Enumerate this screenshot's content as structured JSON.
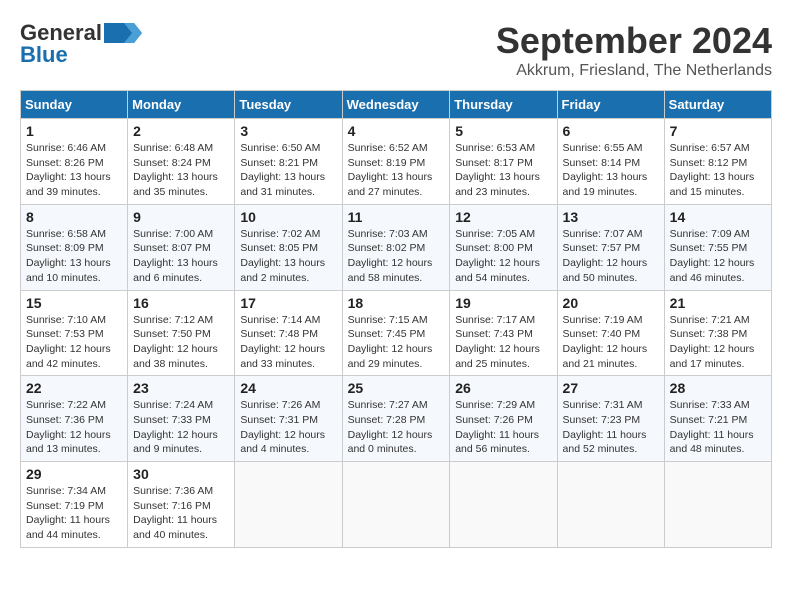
{
  "header": {
    "logo_general": "General",
    "logo_blue": "Blue",
    "month_title": "September 2024",
    "location": "Akkrum, Friesland, The Netherlands"
  },
  "weekdays": [
    "Sunday",
    "Monday",
    "Tuesday",
    "Wednesday",
    "Thursday",
    "Friday",
    "Saturday"
  ],
  "weeks": [
    [
      {
        "day": "1",
        "sunrise": "6:46 AM",
        "sunset": "8:26 PM",
        "daylight": "13 hours and 39 minutes."
      },
      {
        "day": "2",
        "sunrise": "6:48 AM",
        "sunset": "8:24 PM",
        "daylight": "13 hours and 35 minutes."
      },
      {
        "day": "3",
        "sunrise": "6:50 AM",
        "sunset": "8:21 PM",
        "daylight": "13 hours and 31 minutes."
      },
      {
        "day": "4",
        "sunrise": "6:52 AM",
        "sunset": "8:19 PM",
        "daylight": "13 hours and 27 minutes."
      },
      {
        "day": "5",
        "sunrise": "6:53 AM",
        "sunset": "8:17 PM",
        "daylight": "13 hours and 23 minutes."
      },
      {
        "day": "6",
        "sunrise": "6:55 AM",
        "sunset": "8:14 PM",
        "daylight": "13 hours and 19 minutes."
      },
      {
        "day": "7",
        "sunrise": "6:57 AM",
        "sunset": "8:12 PM",
        "daylight": "13 hours and 15 minutes."
      }
    ],
    [
      {
        "day": "8",
        "sunrise": "6:58 AM",
        "sunset": "8:09 PM",
        "daylight": "13 hours and 10 minutes."
      },
      {
        "day": "9",
        "sunrise": "7:00 AM",
        "sunset": "8:07 PM",
        "daylight": "13 hours and 6 minutes."
      },
      {
        "day": "10",
        "sunrise": "7:02 AM",
        "sunset": "8:05 PM",
        "daylight": "13 hours and 2 minutes."
      },
      {
        "day": "11",
        "sunrise": "7:03 AM",
        "sunset": "8:02 PM",
        "daylight": "12 hours and 58 minutes."
      },
      {
        "day": "12",
        "sunrise": "7:05 AM",
        "sunset": "8:00 PM",
        "daylight": "12 hours and 54 minutes."
      },
      {
        "day": "13",
        "sunrise": "7:07 AM",
        "sunset": "7:57 PM",
        "daylight": "12 hours and 50 minutes."
      },
      {
        "day": "14",
        "sunrise": "7:09 AM",
        "sunset": "7:55 PM",
        "daylight": "12 hours and 46 minutes."
      }
    ],
    [
      {
        "day": "15",
        "sunrise": "7:10 AM",
        "sunset": "7:53 PM",
        "daylight": "12 hours and 42 minutes."
      },
      {
        "day": "16",
        "sunrise": "7:12 AM",
        "sunset": "7:50 PM",
        "daylight": "12 hours and 38 minutes."
      },
      {
        "day": "17",
        "sunrise": "7:14 AM",
        "sunset": "7:48 PM",
        "daylight": "12 hours and 33 minutes."
      },
      {
        "day": "18",
        "sunrise": "7:15 AM",
        "sunset": "7:45 PM",
        "daylight": "12 hours and 29 minutes."
      },
      {
        "day": "19",
        "sunrise": "7:17 AM",
        "sunset": "7:43 PM",
        "daylight": "12 hours and 25 minutes."
      },
      {
        "day": "20",
        "sunrise": "7:19 AM",
        "sunset": "7:40 PM",
        "daylight": "12 hours and 21 minutes."
      },
      {
        "day": "21",
        "sunrise": "7:21 AM",
        "sunset": "7:38 PM",
        "daylight": "12 hours and 17 minutes."
      }
    ],
    [
      {
        "day": "22",
        "sunrise": "7:22 AM",
        "sunset": "7:36 PM",
        "daylight": "12 hours and 13 minutes."
      },
      {
        "day": "23",
        "sunrise": "7:24 AM",
        "sunset": "7:33 PM",
        "daylight": "12 hours and 9 minutes."
      },
      {
        "day": "24",
        "sunrise": "7:26 AM",
        "sunset": "7:31 PM",
        "daylight": "12 hours and 4 minutes."
      },
      {
        "day": "25",
        "sunrise": "7:27 AM",
        "sunset": "7:28 PM",
        "daylight": "12 hours and 0 minutes."
      },
      {
        "day": "26",
        "sunrise": "7:29 AM",
        "sunset": "7:26 PM",
        "daylight": "11 hours and 56 minutes."
      },
      {
        "day": "27",
        "sunrise": "7:31 AM",
        "sunset": "7:23 PM",
        "daylight": "11 hours and 52 minutes."
      },
      {
        "day": "28",
        "sunrise": "7:33 AM",
        "sunset": "7:21 PM",
        "daylight": "11 hours and 48 minutes."
      }
    ],
    [
      {
        "day": "29",
        "sunrise": "7:34 AM",
        "sunset": "7:19 PM",
        "daylight": "11 hours and 44 minutes."
      },
      {
        "day": "30",
        "sunrise": "7:36 AM",
        "sunset": "7:16 PM",
        "daylight": "11 hours and 40 minutes."
      },
      null,
      null,
      null,
      null,
      null
    ]
  ]
}
